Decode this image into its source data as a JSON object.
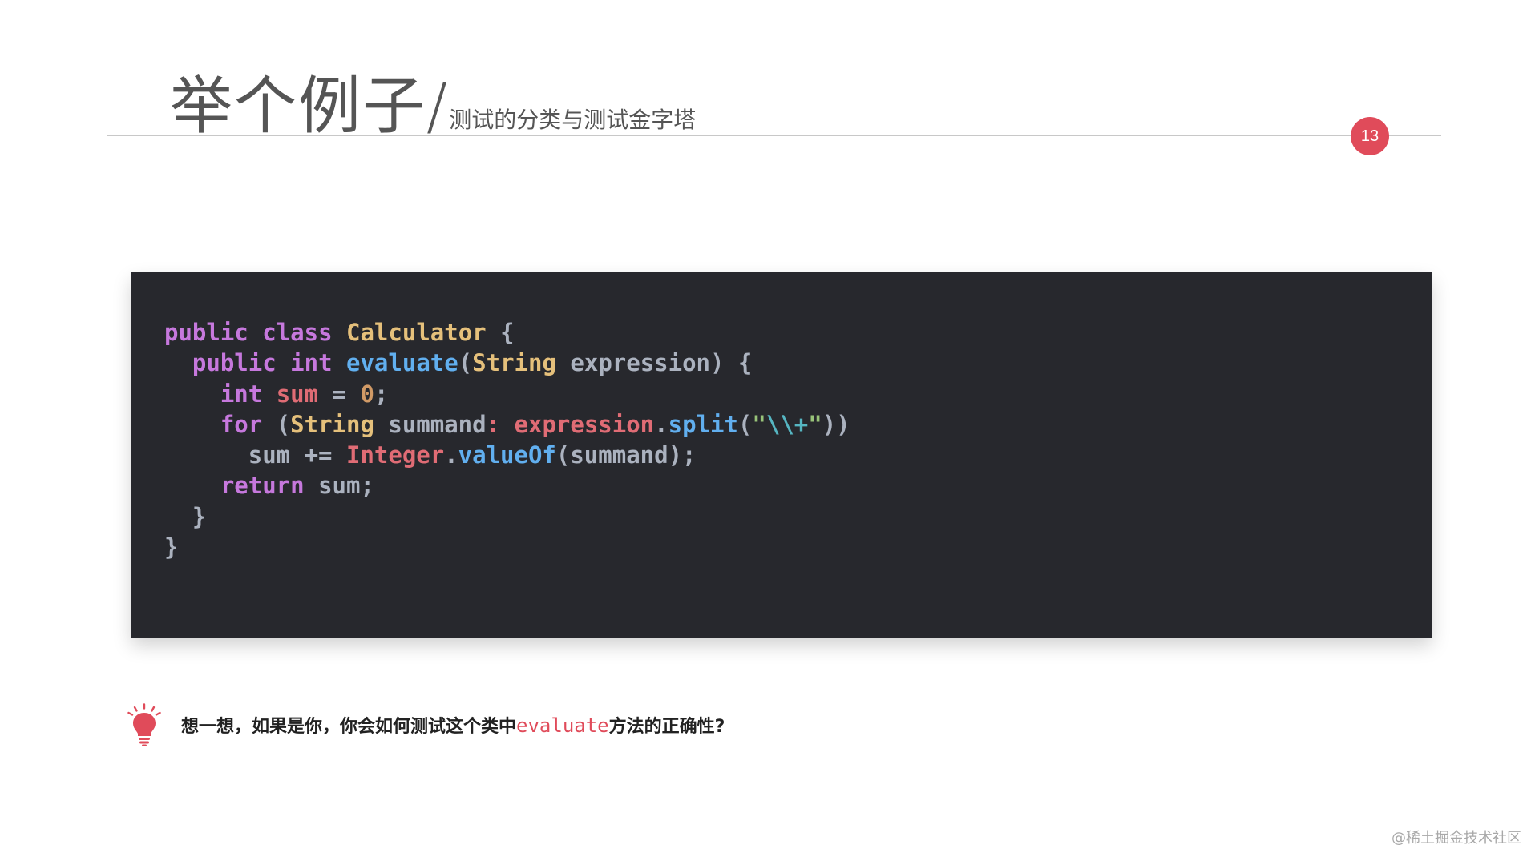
{
  "slide": {
    "title": "举个例子",
    "title_separator": "/",
    "subtitle": "测试的分类与测试金字塔",
    "page_number": "13",
    "accent_color": "#e04b5a",
    "code_background": "#27282d"
  },
  "code": {
    "language": "java",
    "lines": [
      [
        {
          "t": "public",
          "c": "kw"
        },
        {
          "t": " ",
          "c": "pl"
        },
        {
          "t": "class",
          "c": "kw"
        },
        {
          "t": " ",
          "c": "pl"
        },
        {
          "t": "Calculator",
          "c": "cls"
        },
        {
          "t": " {",
          "c": "pl"
        }
      ],
      [
        {
          "t": "  ",
          "c": "pl"
        },
        {
          "t": "public",
          "c": "kw"
        },
        {
          "t": " ",
          "c": "pl"
        },
        {
          "t": "int",
          "c": "kw"
        },
        {
          "t": " ",
          "c": "pl"
        },
        {
          "t": "evaluate",
          "c": "fn"
        },
        {
          "t": "(",
          "c": "pl"
        },
        {
          "t": "String",
          "c": "cls"
        },
        {
          "t": " expression) {",
          "c": "pl"
        }
      ],
      [
        {
          "t": "    ",
          "c": "pl"
        },
        {
          "t": "int",
          "c": "kw"
        },
        {
          "t": " ",
          "c": "pl"
        },
        {
          "t": "sum",
          "c": "var"
        },
        {
          "t": " = ",
          "c": "pl"
        },
        {
          "t": "0",
          "c": "num"
        },
        {
          "t": ";",
          "c": "pl"
        }
      ],
      [
        {
          "t": "    ",
          "c": "pl"
        },
        {
          "t": "for",
          "c": "kw"
        },
        {
          "t": " (",
          "c": "pl"
        },
        {
          "t": "String",
          "c": "cls"
        },
        {
          "t": " summand",
          "c": "pl"
        },
        {
          "t": ": ",
          "c": "var"
        },
        {
          "t": "expression",
          "c": "var"
        },
        {
          "t": ".",
          "c": "pl"
        },
        {
          "t": "split",
          "c": "fn"
        },
        {
          "t": "(",
          "c": "pl"
        },
        {
          "t": "\"",
          "c": "str"
        },
        {
          "t": "\\\\+",
          "c": "esc"
        },
        {
          "t": "\"",
          "c": "str"
        },
        {
          "t": "))",
          "c": "pl"
        }
      ],
      [
        {
          "t": "      sum += ",
          "c": "pl"
        },
        {
          "t": "Integer",
          "c": "var"
        },
        {
          "t": ".",
          "c": "pl"
        },
        {
          "t": "valueOf",
          "c": "fn"
        },
        {
          "t": "(summand);",
          "c": "pl"
        }
      ],
      [
        {
          "t": "    ",
          "c": "pl"
        },
        {
          "t": "return",
          "c": "kw"
        },
        {
          "t": " sum;",
          "c": "pl"
        }
      ],
      [
        {
          "t": "  }",
          "c": "pl"
        }
      ],
      [
        {
          "t": "}",
          "c": "pl"
        }
      ]
    ]
  },
  "tip": {
    "icon": "lightbulb-icon",
    "text_before": "想一想，如果是你，你会如何测试这个类中",
    "highlight": "evaluate",
    "text_after": "方法的正确性?"
  },
  "watermark": "@稀土掘金技术社区"
}
